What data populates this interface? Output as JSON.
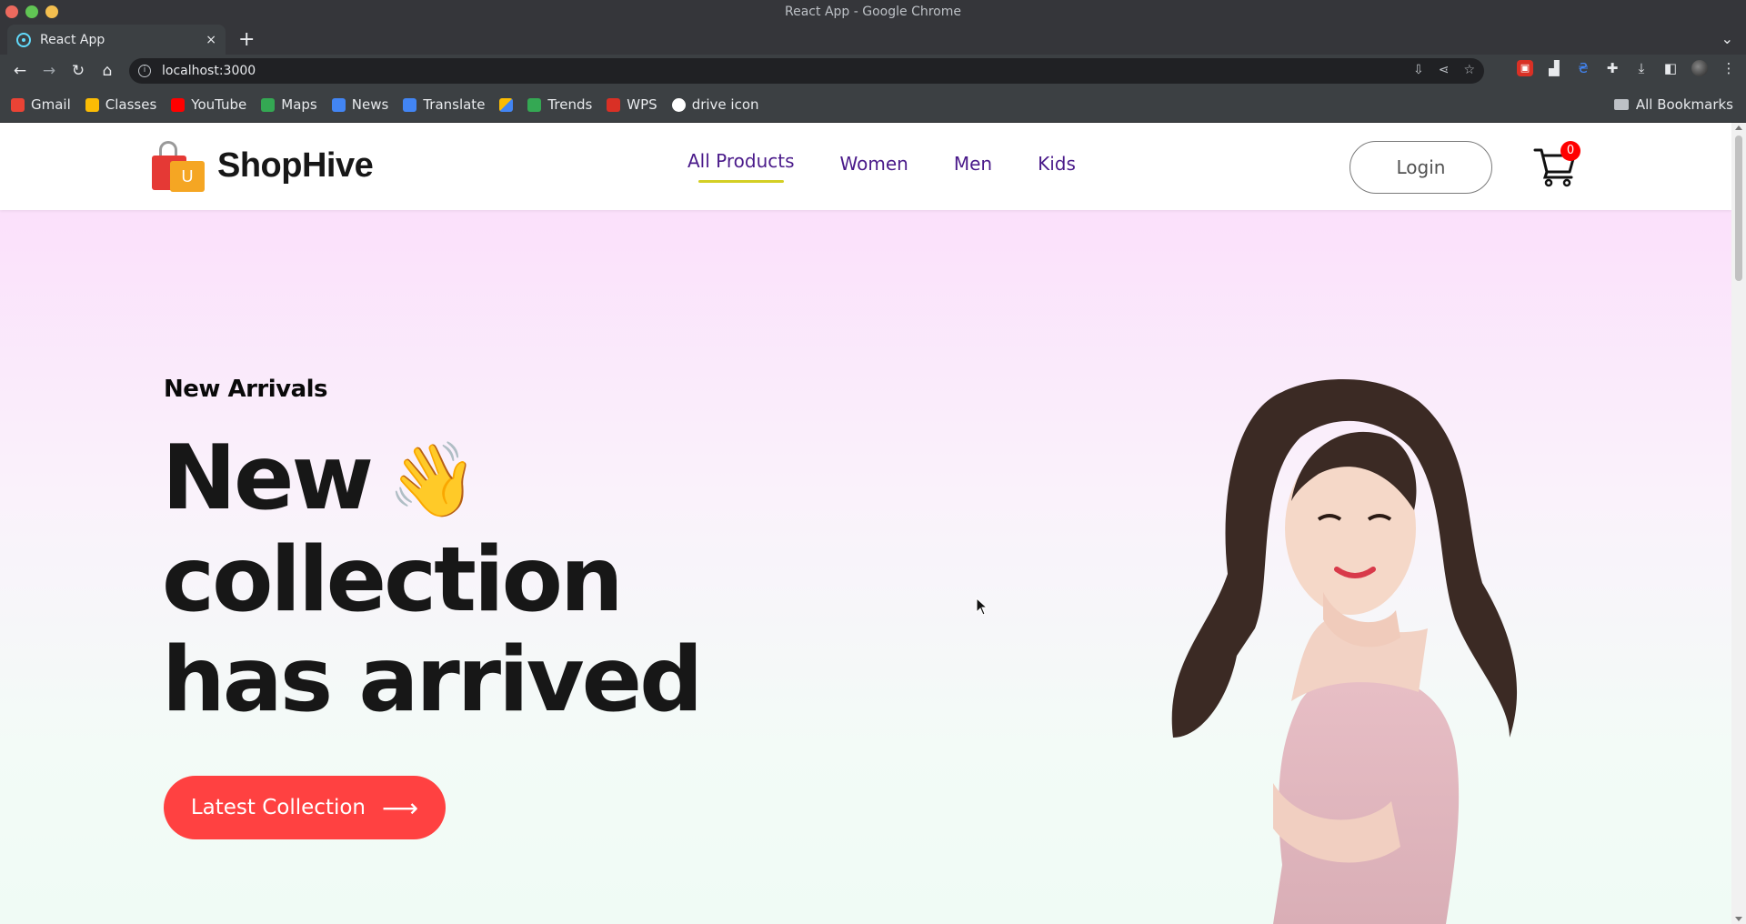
{
  "window": {
    "title": "React App - Google Chrome"
  },
  "tab": {
    "title": "React App",
    "close": "×",
    "new_tab": "+"
  },
  "address": {
    "url": "localhost:3000"
  },
  "bookmarks": {
    "items": [
      {
        "label": "Gmail",
        "color": "#ea4335"
      },
      {
        "label": "Classes",
        "color": "#fbbc04"
      },
      {
        "label": "YouTube",
        "color": "#ff0000"
      },
      {
        "label": "Maps",
        "color": "#34a853"
      },
      {
        "label": "News",
        "color": "#4285f4"
      },
      {
        "label": "Translate",
        "color": "#4285f4"
      },
      {
        "label": "",
        "color": "#4285f4"
      },
      {
        "label": "Trends",
        "color": "#34a853"
      },
      {
        "label": "WPS",
        "color": "#d93025"
      },
      {
        "label": "drive icon",
        "color": "#ffffff"
      }
    ],
    "all_label": "All Bookmarks"
  },
  "site": {
    "brand": "ShopHive",
    "bag_letter": "U",
    "nav": [
      "All Products",
      "Women",
      "Men",
      "Kids"
    ],
    "login_label": "Login",
    "cart_count": "0"
  },
  "hero": {
    "eyebrow": "New Arrivals",
    "line1": "New",
    "line2": "collection",
    "line3": "has arrived",
    "hand_emoji": "👋",
    "cta_label": "Latest Collection",
    "cta_arrow": "⟶"
  },
  "colors": {
    "accent": "#ff4141",
    "nav_text": "#4a1a8a",
    "nav_underline": "#d4cf24",
    "hero_top": "#fbe0fb",
    "hero_bottom": "#f0fbf5"
  }
}
